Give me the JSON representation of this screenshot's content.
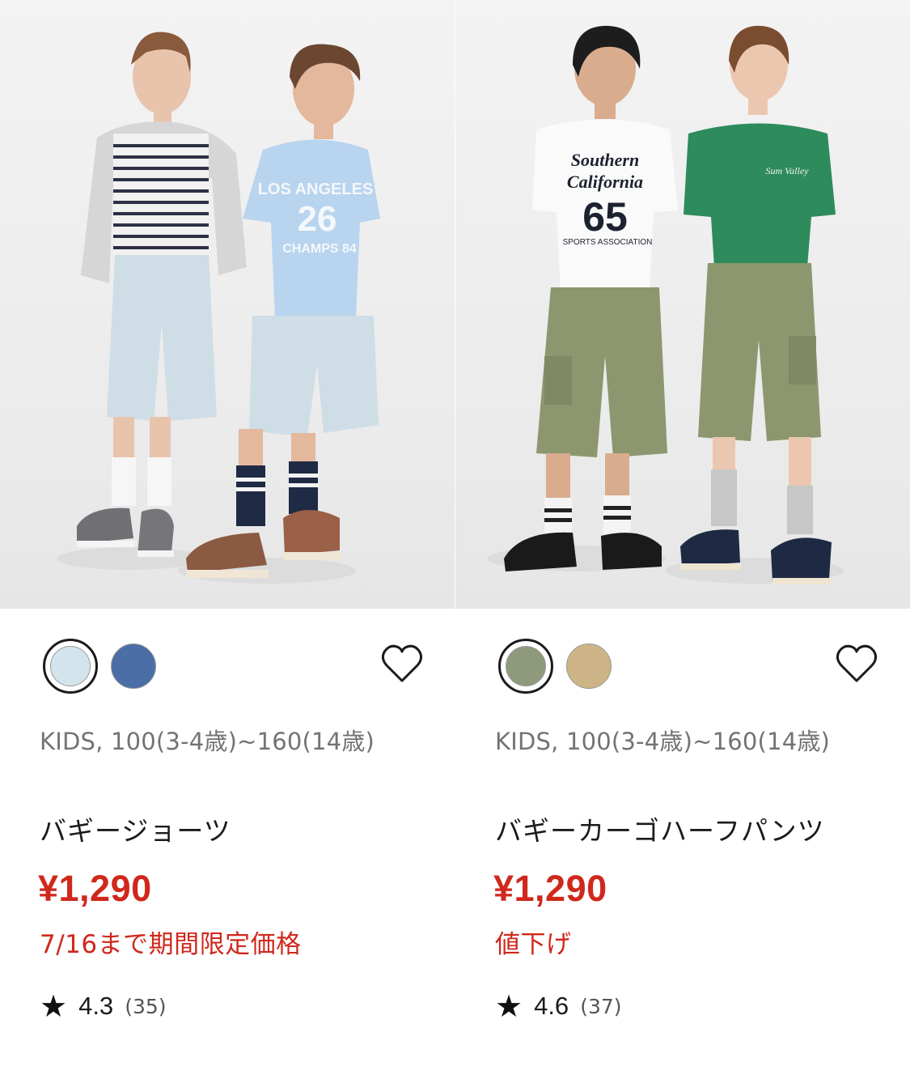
{
  "products": [
    {
      "category": "KIDS, 100(3-4歳)~160(14歳)",
      "name": "バギージョーツ",
      "price": "¥1,290",
      "promo": "7/16まで期間限定価格",
      "rating": "4.3",
      "review_count": "(35)",
      "swatches": [
        {
          "color": "#d4e4ec",
          "selected": true
        },
        {
          "color": "#4a6ea5",
          "selected": false
        }
      ],
      "favorite_icon": "heart-outline-icon",
      "colors": {
        "shirt_a": "#f1f1f1",
        "shirt_b": "#b9d4ee",
        "shorts": "#cfdde6",
        "sweater": "#d6d6d6"
      }
    },
    {
      "category": "KIDS, 100(3-4歳)~160(14歳)",
      "name": "バギーカーゴハーフパンツ",
      "price": "¥1,290",
      "promo": "値下げ",
      "rating": "4.6",
      "review_count": "(37)",
      "swatches": [
        {
          "color": "#8f9a7c",
          "selected": true
        },
        {
          "color": "#cdb486",
          "selected": false
        }
      ],
      "favorite_icon": "heart-outline-icon",
      "colors": {
        "shirt_a": "#fafafa",
        "shirt_b": "#2e8b5c",
        "shorts": "#8c976f"
      }
    }
  ],
  "theme": {
    "price_color": "#d0281c",
    "text_color": "#1b1b1b",
    "meta_color": "#737373"
  },
  "icons": {
    "star": "★"
  }
}
